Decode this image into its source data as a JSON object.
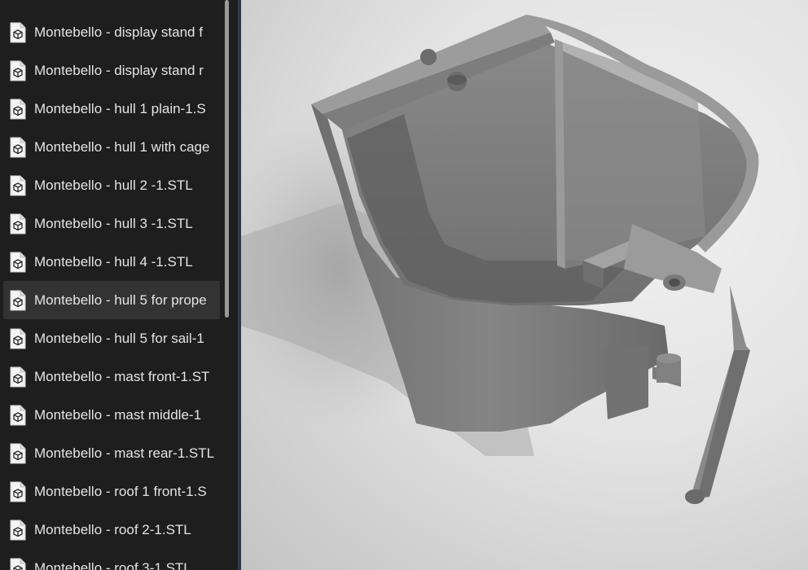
{
  "file_list": {
    "items": [
      {
        "name": "Montebello - display stand f",
        "icon": "stl-file-icon",
        "selected": false
      },
      {
        "name": "Montebello - display stand r",
        "icon": "stl-file-icon",
        "selected": false
      },
      {
        "name": "Montebello - hull 1 plain-1.S",
        "icon": "stl-file-icon",
        "selected": false
      },
      {
        "name": "Montebello - hull 1 with cage",
        "icon": "stl-file-icon",
        "selected": false
      },
      {
        "name": "Montebello - hull 2 -1.STL",
        "icon": "stl-file-icon",
        "selected": false
      },
      {
        "name": "Montebello - hull 3 -1.STL",
        "icon": "stl-file-icon",
        "selected": false
      },
      {
        "name": "Montebello - hull 4 -1.STL",
        "icon": "stl-file-icon",
        "selected": false
      },
      {
        "name": "Montebello - hull 5 for prope",
        "icon": "stl-file-icon",
        "selected": true
      },
      {
        "name": "Montebello - hull 5 for sail-1",
        "icon": "stl-file-icon",
        "selected": false
      },
      {
        "name": "Montebello - mast front-1.ST",
        "icon": "stl-file-icon",
        "selected": false
      },
      {
        "name": "Montebello - mast middle-1",
        "icon": "stl-file-icon",
        "selected": false
      },
      {
        "name": "Montebello - mast rear-1.STL",
        "icon": "stl-file-icon",
        "selected": false
      },
      {
        "name": "Montebello - roof 1 front-1.S",
        "icon": "stl-file-icon",
        "selected": false
      },
      {
        "name": "Montebello - roof 2-1.STL",
        "icon": "stl-file-icon",
        "selected": false
      },
      {
        "name": "Montebello - roof 3-1.STL",
        "icon": "stl-file-icon",
        "selected": false
      }
    ]
  },
  "preview": {
    "model_color": "#7a7a7a",
    "background_color": "#e4e4e4"
  },
  "colors": {
    "pane_background": "#1e1e1e",
    "selected_row": "#333333",
    "text": "#e4e4e4",
    "divider": "#2b3a4a"
  }
}
